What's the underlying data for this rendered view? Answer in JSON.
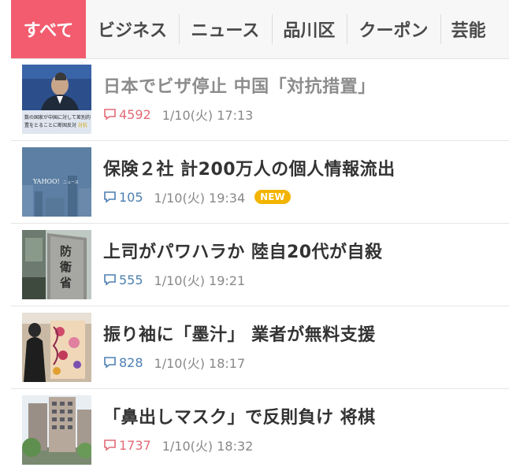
{
  "tabs": [
    {
      "label": "すべて",
      "active": true
    },
    {
      "label": "ビジネス",
      "active": false
    },
    {
      "label": "ニュース",
      "active": false
    },
    {
      "label": "品川区",
      "active": false
    },
    {
      "label": "クーポン",
      "active": false
    },
    {
      "label": "芸能",
      "active": false
    }
  ],
  "articles": [
    {
      "title": "日本でビザ停止 中国「対抗措置」",
      "comments": "4592",
      "date": "1/10(火) 17:13",
      "badge": "",
      "thumbnail_icon": "press-conference-photo",
      "thumbnail_text": "数の国家が中国に対して差別的 置をとることに断固反対 対抗"
    },
    {
      "title": "保険２社 計200万人の個人情報流出",
      "comments": "105",
      "date": "1/10(火) 19:34",
      "badge": "NEW",
      "thumbnail_icon": "yahoo-news-placeholder",
      "thumbnail_text": "YAHOO! ニュース"
    },
    {
      "title": "上司がパワハラか 陸自20代が自殺",
      "comments": "555",
      "date": "1/10(火) 19:21",
      "badge": "",
      "thumbnail_icon": "ministry-sign-photo",
      "thumbnail_text": "防衛省"
    },
    {
      "title": "振り袖に「墨汁」 業者が無料支援",
      "comments": "828",
      "date": "1/10(火) 18:17",
      "badge": "",
      "thumbnail_icon": "kimono-photo",
      "thumbnail_text": ""
    },
    {
      "title": "「鼻出しマスク」で反則負け 将棋",
      "comments": "1737",
      "date": "1/10(火) 18:32",
      "badge": "",
      "thumbnail_icon": "building-photo",
      "thumbnail_text": ""
    }
  ],
  "colors": {
    "accent": "#f25c6e",
    "comment_normal": "#4d7fb0",
    "comment_hot": "#e36a77",
    "new_badge": "#f3b400"
  }
}
